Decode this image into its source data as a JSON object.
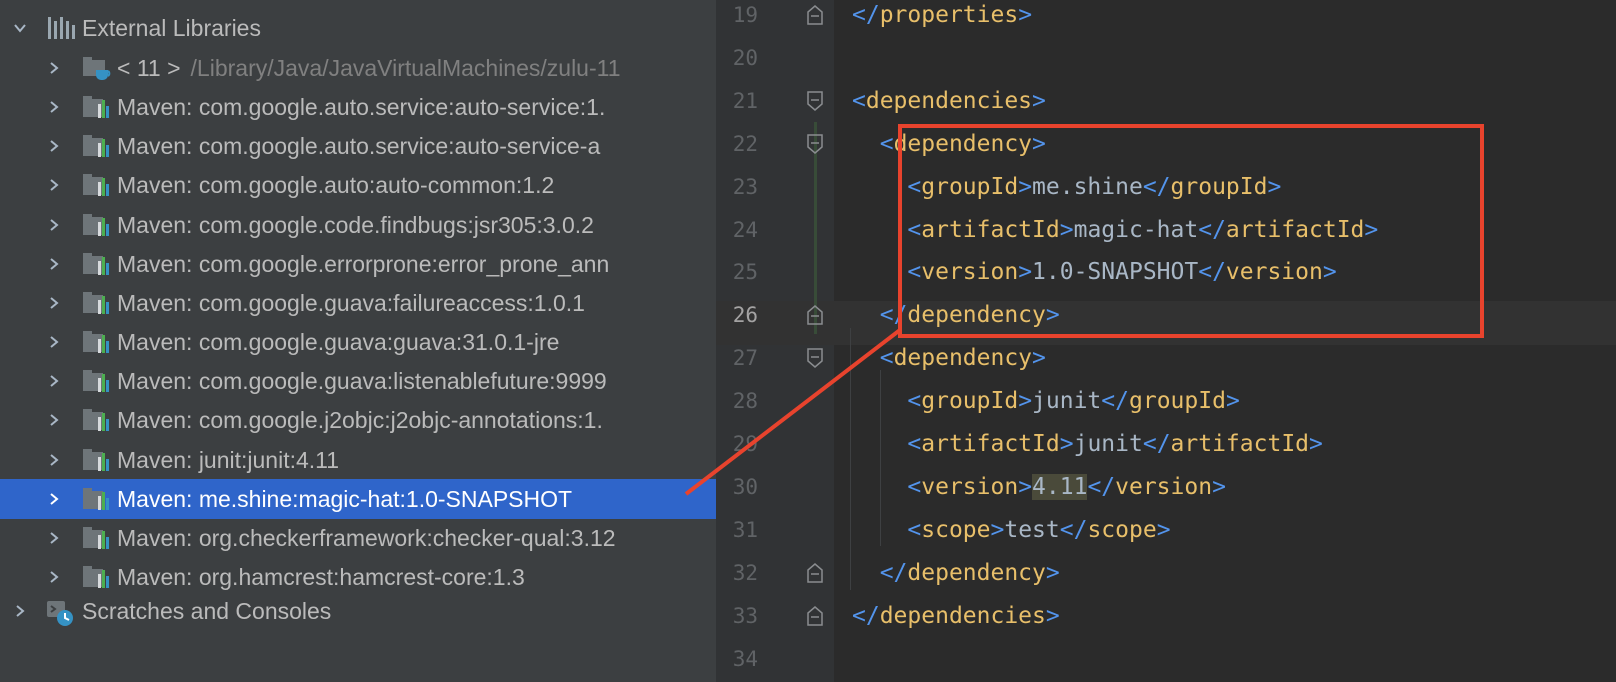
{
  "project_tree": {
    "root_label": "External Libraries",
    "items": [
      {
        "label": "< 11 >",
        "path": "/Library/Java/JavaVirtualMachines/zulu-11",
        "icon": "jdk-folder-icon"
      },
      {
        "label": "Maven: com.google.auto.service:auto-service:1.",
        "icon": "library-icon"
      },
      {
        "label": "Maven: com.google.auto.service:auto-service-a",
        "icon": "library-icon"
      },
      {
        "label": "Maven: com.google.auto:auto-common:1.2",
        "icon": "library-icon"
      },
      {
        "label": "Maven: com.google.code.findbugs:jsr305:3.0.2",
        "icon": "library-icon"
      },
      {
        "label": "Maven: com.google.errorprone:error_prone_ann",
        "icon": "library-icon"
      },
      {
        "label": "Maven: com.google.guava:failureaccess:1.0.1",
        "icon": "library-icon"
      },
      {
        "label": "Maven: com.google.guava:guava:31.0.1-jre",
        "icon": "library-icon"
      },
      {
        "label": "Maven: com.google.guava:listenablefuture:9999",
        "icon": "library-icon"
      },
      {
        "label": "Maven: com.google.j2objc:j2objc-annotations:1.",
        "icon": "library-icon"
      },
      {
        "label": "Maven: junit:junit:4.11",
        "icon": "library-icon"
      },
      {
        "label": "Maven: me.shine:magic-hat:1.0-SNAPSHOT",
        "icon": "library-icon",
        "selected": true
      },
      {
        "label": "Maven: org.checkerframework:checker-qual:3.12",
        "icon": "library-icon"
      },
      {
        "label": "Maven: org.hamcrest:hamcrest-core:1.3",
        "icon": "library-icon"
      }
    ],
    "scratches_label": "Scratches and Consoles"
  },
  "editor": {
    "current_line": "26",
    "lines": [
      {
        "n": "19",
        "fold": "end",
        "text": "</properties>"
      },
      {
        "n": "20",
        "text": ""
      },
      {
        "n": "21",
        "fold": "start",
        "text": "<dependencies>"
      },
      {
        "n": "22",
        "fold": "start",
        "text": "  <dependency>"
      },
      {
        "n": "23",
        "text": "    <groupId>me.shine</groupId>"
      },
      {
        "n": "24",
        "text": "    <artifactId>magic-hat</artifactId>"
      },
      {
        "n": "25",
        "text": "    <version>1.0-SNAPSHOT</version>"
      },
      {
        "n": "26",
        "fold": "end",
        "text": "  </dependency>"
      },
      {
        "n": "27",
        "fold": "start",
        "text": "  <dependency>"
      },
      {
        "n": "28",
        "text": "    <groupId>junit</groupId>"
      },
      {
        "n": "29",
        "text": "    <artifactId>junit</artifactId>"
      },
      {
        "n": "30",
        "text": "    <version>4.11</version>"
      },
      {
        "n": "31",
        "text": "    <scope>test</scope>"
      },
      {
        "n": "32",
        "fold": "end",
        "text": "  </dependency>"
      },
      {
        "n": "33",
        "fold": "end",
        "text": "</dependencies>"
      },
      {
        "n": "34",
        "text": ""
      }
    ]
  },
  "annotation": {
    "color": "#e8432d"
  },
  "colors": {
    "tree_bg": "#3c3f41",
    "selection": "#2f65ca",
    "editor_bg": "#2b2b2b",
    "tag": "#e8bf6a",
    "bracket": "#5394ec",
    "text": "#a9b7c6",
    "line_number": "#606366"
  }
}
